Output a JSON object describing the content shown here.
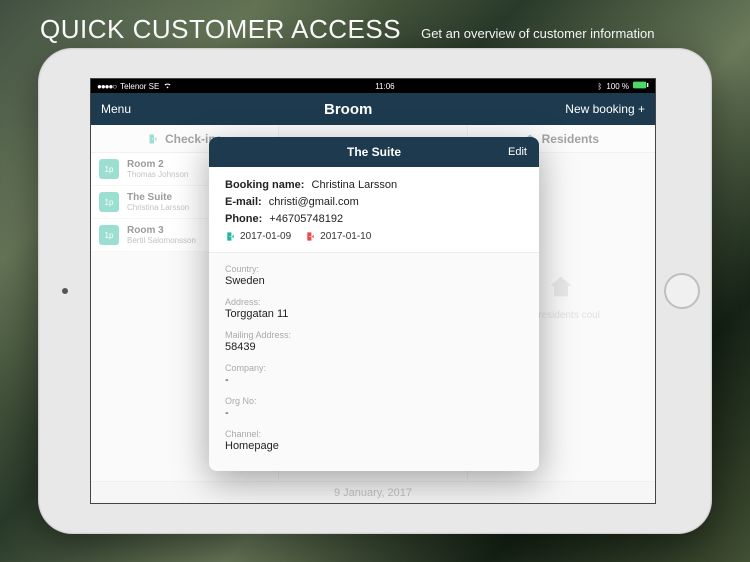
{
  "promo": {
    "title": "QUICK CUSTOMER ACCESS",
    "subtitle": "Get an overview of customer information"
  },
  "statusbar": {
    "carrier": "Telenor SE",
    "time": "11:06",
    "battery": "100 %"
  },
  "navbar": {
    "menu": "Menu",
    "title": "Broom",
    "newbooking": "New booking +"
  },
  "columns": {
    "checkins": {
      "header": "Check-ins",
      "items": [
        {
          "badge": "1p",
          "room": "Room 2",
          "guest": "Thomas Johnson"
        },
        {
          "badge": "1p",
          "room": "The Suite",
          "guest": "Christina Larsson"
        },
        {
          "badge": "1p",
          "room": "Room 3",
          "guest": "Bertil Salomonsson"
        }
      ]
    },
    "residents": {
      "header": "Residents",
      "empty": "No residents coul"
    }
  },
  "footer_date": "9 January, 2017",
  "modal": {
    "title": "The Suite",
    "edit": "Edit",
    "booking_name_label": "Booking name:",
    "booking_name": "Christina Larsson",
    "email_label": "E-mail:",
    "email": "christi@gmail.com",
    "phone_label": "Phone:",
    "phone": "+46705748192",
    "checkin_date": "2017-01-09",
    "checkout_date": "2017-01-10",
    "fields": [
      {
        "label": "Country:",
        "value": "Sweden"
      },
      {
        "label": "Address:",
        "value": "Torggatan 11"
      },
      {
        "label": "Mailing Address:",
        "value": "58439"
      },
      {
        "label": "Company:",
        "value": "-"
      },
      {
        "label": "Org No:",
        "value": "-"
      },
      {
        "label": "Channel:",
        "value": "Homepage"
      }
    ]
  }
}
